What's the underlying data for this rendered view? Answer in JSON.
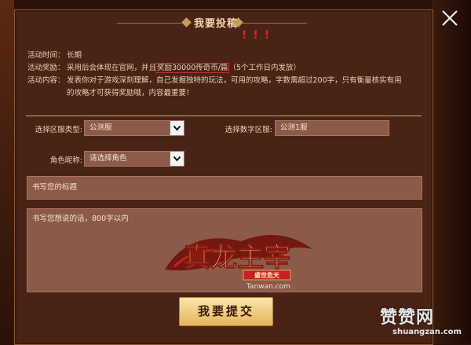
{
  "dialog": {
    "title": "我要投稿",
    "annotation_marks": "!!!",
    "info": {
      "time_label": "活动时间：",
      "time_value": "长期",
      "reward_label": "活动奖励：",
      "reward_prefix": "采用后会体现在官网，并且",
      "reward_highlight": "奖励30000传奇币/篇",
      "reward_suffix": "（5个工作日内发放）",
      "content_label": "活动内容：",
      "content_line1": "发表你对于游戏深刻理解，自己发掘独特的玩法，可用的攻略，字数需超过200字，只有衡量核实有用",
      "content_line2": "的攻略才可获得奖励哦，内容最重要！"
    },
    "form": {
      "server_type_label": "选择区服类型:",
      "server_type_value": "公测服",
      "server_number_label": "选择数字区服:",
      "server_number_value": "公测1服",
      "role_label": "角色昵称:",
      "role_value": "请选择角色",
      "title_placeholder": "书写您的标题",
      "content_placeholder": "书写您想说的话，800字以内"
    },
    "submit_label": "我要提交",
    "logo": {
      "main_text": "真龙主宰",
      "tag_text": "盛世危天",
      "url_text": "Tanwan.com"
    }
  },
  "watermark": {
    "name": "赞赞网",
    "url": "shuangzan.com"
  },
  "colors": {
    "panel": "#4a2317",
    "field": "#8c5a48",
    "highlight_border": "#d4262a",
    "button": "#e5b45a"
  }
}
